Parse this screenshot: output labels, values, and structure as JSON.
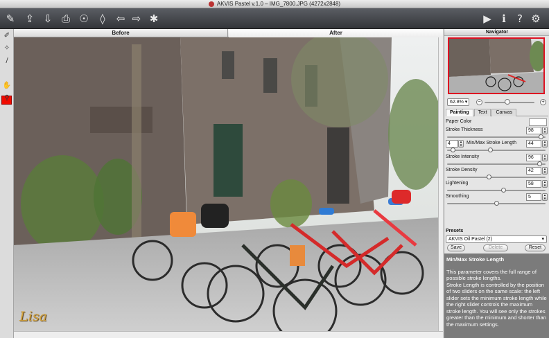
{
  "window": {
    "title": "AKVIS Pastel v.1.0 – IMG_7800.JPG (4272x2848)"
  },
  "toolbar": {
    "left_icons": [
      "logo-brush-icon",
      "open-icon",
      "save-icon",
      "print-icon",
      "share-icon",
      "eraser-icon",
      "undo-icon",
      "redo-icon",
      "batch-gear-icon"
    ],
    "right_icons": [
      "run-icon",
      "info-icon",
      "help-icon",
      "preferences-icon"
    ]
  },
  "view_tabs": {
    "before": "Before",
    "after": "After"
  },
  "left_tools": [
    "pencil-icon",
    "magic-brush-icon",
    "brush-icon",
    "color-swatch",
    "hand-icon",
    "zoom-icon"
  ],
  "accent_color": "#f00a00",
  "canvas": {
    "signature": "Lisa"
  },
  "navigator": {
    "title": "Navigator",
    "zoom": "62.8%",
    "zoom_level": 0.45
  },
  "settings_tabs": [
    "Painting",
    "Text",
    "Canvas"
  ],
  "active_settings_tab": "Painting",
  "params": {
    "paper_color": {
      "label": "Paper Color",
      "value": "#ffffff"
    },
    "stroke_thickness": {
      "label": "Stroke Thickness",
      "value": "98",
      "level": 0.98
    },
    "stroke_length": {
      "label": "Min/Max Stroke Length",
      "min": "4",
      "max": "44",
      "min_level": 0.04,
      "max_level": 0.44
    },
    "stroke_intensity": {
      "label": "Stroke Intensity",
      "value": "96",
      "level": 0.96
    },
    "stroke_density": {
      "label": "Stroke Density",
      "value": "42",
      "level": 0.42
    },
    "lightening": {
      "label": "Lightening",
      "value": "58",
      "level": 0.58
    },
    "smoothing": {
      "label": "Smoothing",
      "value": "5",
      "level": 0.5
    }
  },
  "presets": {
    "label": "Presets",
    "selected": "AKVIS Oil Pastel (2)",
    "save": "Save",
    "delete": "Delete",
    "reset": "Reset"
  },
  "help": {
    "title": "Min/Max Stroke Length",
    "p1": "This parameter covers the full range of possible stroke lengths.",
    "p2": "Stroke Length is controlled by the position of two sliders on the same scale: the left slider sets the minimum stroke length while the right slider controls the maximum stroke length. You will see only the strokes greater than the minimum and shorter than the maximum settings."
  }
}
